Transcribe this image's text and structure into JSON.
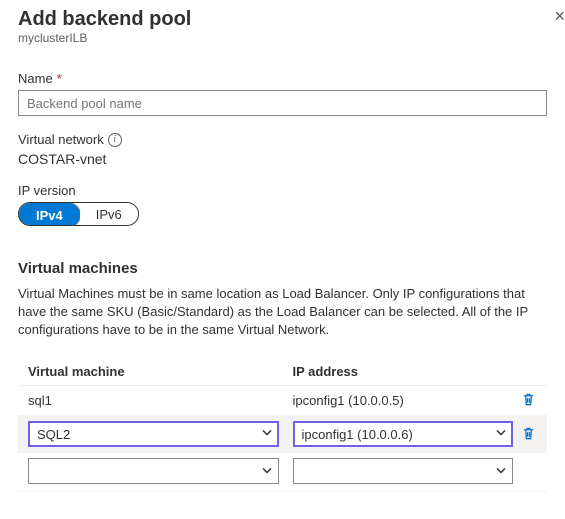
{
  "header": {
    "title": "Add backend pool",
    "subtitle": "myclusterILB"
  },
  "name": {
    "label": "Name",
    "placeholder": "Backend pool name"
  },
  "vnet": {
    "label": "Virtual network",
    "value": "COSTAR-vnet"
  },
  "ipver": {
    "label": "IP version",
    "v4": "IPv4",
    "v6": "IPv6"
  },
  "vms": {
    "heading": "Virtual machines",
    "desc": "Virtual Machines must be in same location as Load Balancer. Only IP configurations that have the same SKU (Basic/Standard) as the Load Balancer can be selected. All of the IP configurations have to be in the same Virtual Network.",
    "col_vm": "Virtual machine",
    "col_ip": "IP address",
    "rows": [
      {
        "vm": "sql1",
        "ip": "ipconfig1 (10.0.0.5)"
      },
      {
        "vm": "SQL2",
        "ip": "ipconfig1 (10.0.0.6)"
      },
      {
        "vm": "",
        "ip": ""
      }
    ]
  }
}
